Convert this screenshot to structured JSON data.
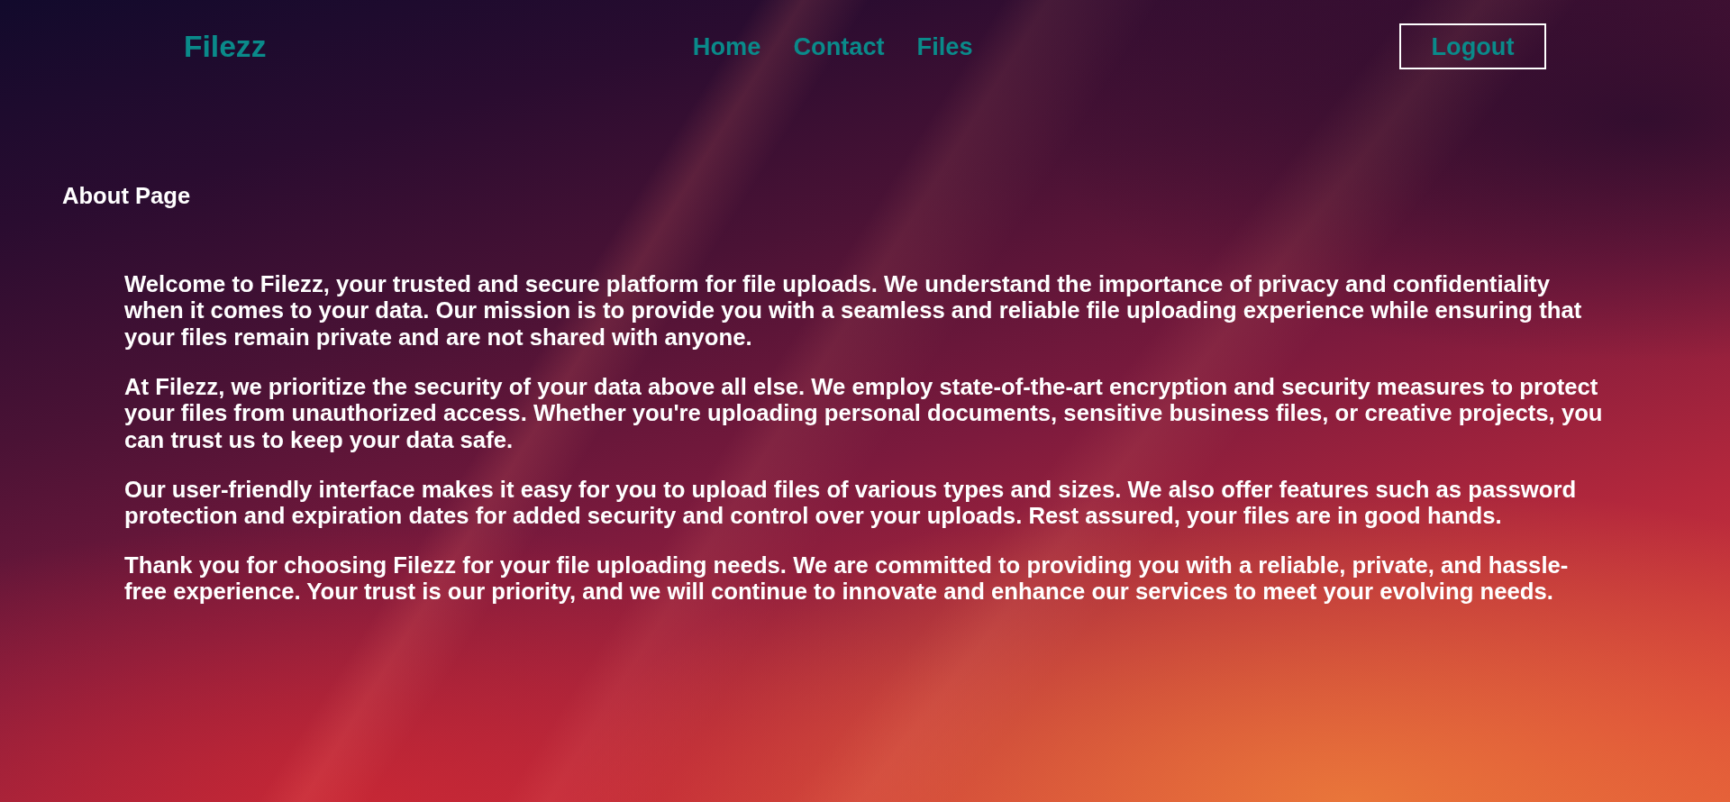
{
  "brand": {
    "name": "Filezz"
  },
  "nav": {
    "links": [
      {
        "label": "Home"
      },
      {
        "label": "Contact"
      },
      {
        "label": "Files"
      }
    ]
  },
  "logout_button": {
    "label": "Logout"
  },
  "page_heading": "About Page",
  "paragraphs": [
    "Welcome to Filezz, your trusted and secure platform for file uploads. We understand the importance of privacy and confidentiality when it comes to your data. Our mission is to provide you with a seamless and reliable file uploading experience while ensuring that your files remain private and are not shared with anyone.",
    "At Filezz, we prioritize the security of your data above all else. We employ state-of-the-art encryption and security measures to protect your files from unauthorized access. Whether you're uploading personal documents, sensitive business files, or creative projects, you can trust us to keep your data safe.",
    "Our user-friendly interface makes it easy for you to upload files of various types and sizes. We also offer features such as password protection and expiration dates for added security and control over your uploads. Rest assured, your files are in good hands.",
    "Thank you for choosing Filezz for your file uploading needs. We are committed to providing you with a reliable, private, and hassle-free experience. Your trust is our priority, and we will continue to innovate and enhance our services to meet your evolving needs."
  ]
}
